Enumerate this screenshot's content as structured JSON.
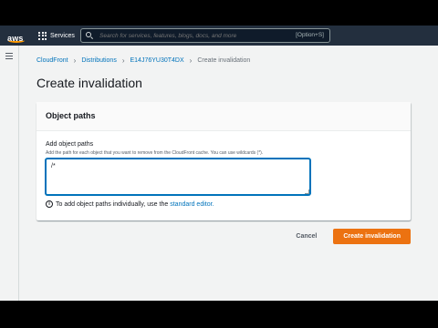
{
  "topnav": {
    "logo_text": "aws",
    "services_label": "Services",
    "search_placeholder": "Search for services, features, blogs, docs, and more",
    "search_shortcut": "[Option+S]"
  },
  "breadcrumb": {
    "items": [
      "CloudFront",
      "Distributions",
      "E14J76YU30T4DX"
    ],
    "current": "Create invalidation"
  },
  "page": {
    "title": "Create invalidation"
  },
  "panel": {
    "title": "Object paths",
    "field_label": "Add object paths",
    "field_description": "Add the path for each object that you want to remove from the CloudFront cache. You can use wildcards (*).",
    "textarea_value": "/*",
    "info_text": "To add object paths individually, use the",
    "info_link": "standard editor."
  },
  "actions": {
    "cancel_label": "Cancel",
    "create_label": "Create invalidation"
  },
  "colors": {
    "nav_bg": "#232f3e",
    "link": "#0073bb",
    "primary_button": "#ec7211",
    "page_bg": "#f2f3f3"
  }
}
